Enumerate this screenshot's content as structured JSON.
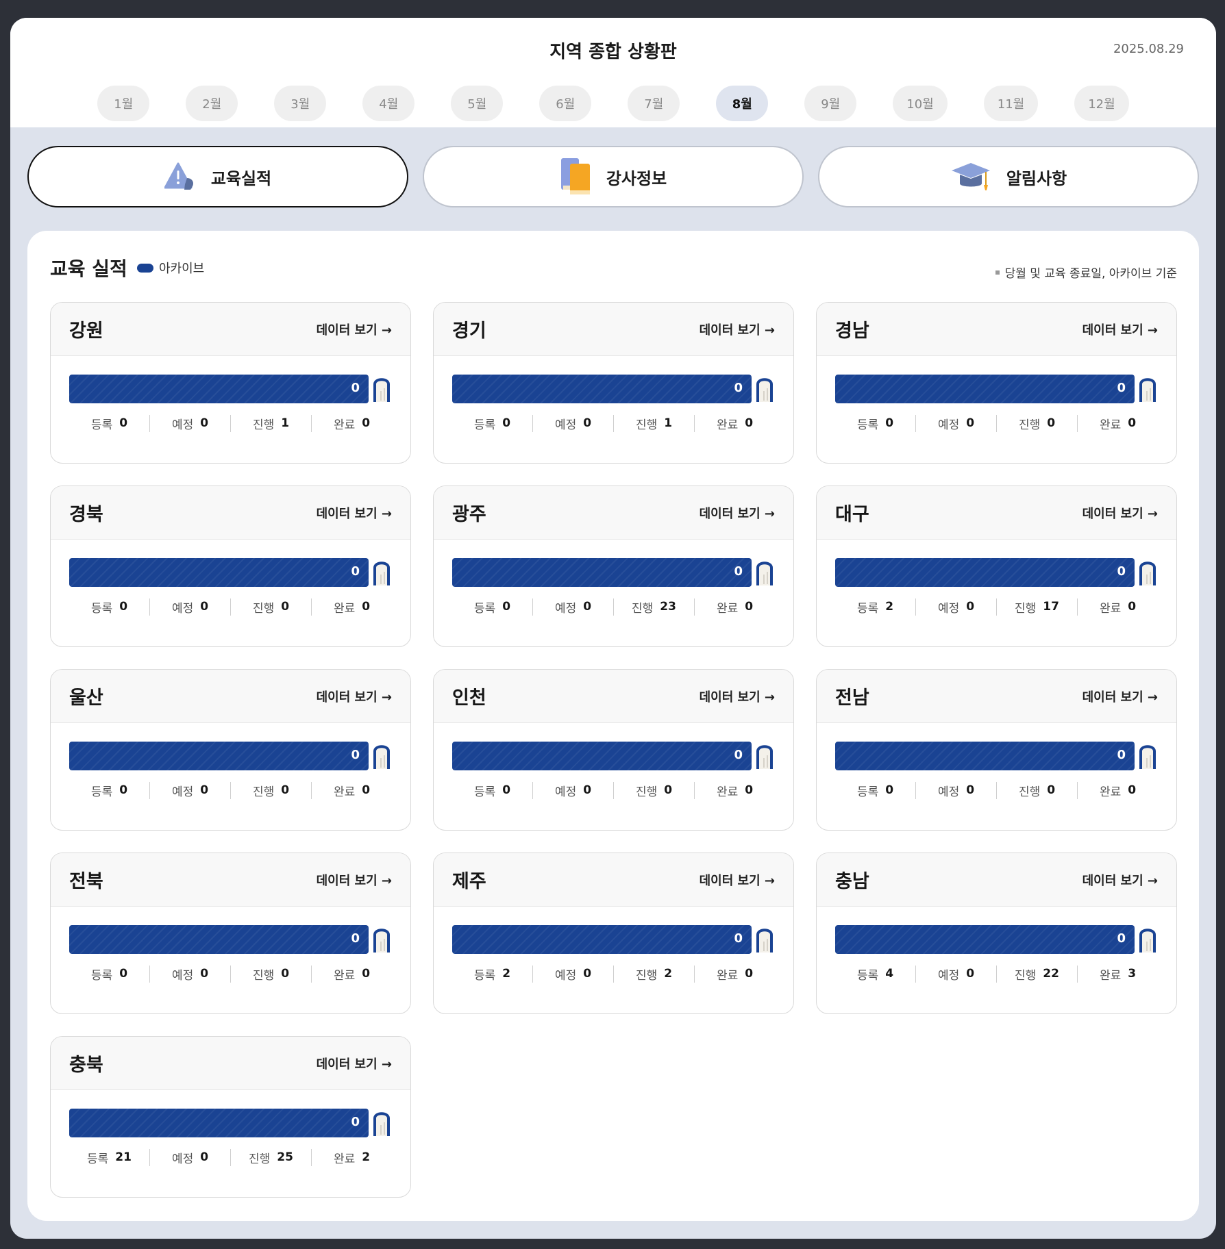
{
  "header": {
    "title": "지역 종합 상황판",
    "date": "2025.08.29",
    "months": [
      "1월",
      "2월",
      "3월",
      "4월",
      "5월",
      "6월",
      "7월",
      "8월",
      "9월",
      "10월",
      "11월",
      "12월"
    ],
    "active_month": "8월"
  },
  "tabs": [
    {
      "label": "교육실적",
      "icon": "warning-icon",
      "active": true
    },
    {
      "label": "강사정보",
      "icon": "books-icon",
      "active": false
    },
    {
      "label": "알림사항",
      "icon": "graduation-cap-icon",
      "active": false
    }
  ],
  "panel": {
    "title": "교육 실적",
    "legend_label": "아카이브",
    "note": "당월 및 교육 종료일, 아카이브 기준",
    "view_label": "데이터 보기 →",
    "stat_labels": {
      "registered": "등록",
      "scheduled": "예정",
      "in_progress": "진행",
      "completed": "완료"
    }
  },
  "colors": {
    "bar": "#1a4393",
    "accent_active_border": "#111111"
  },
  "regions": [
    {
      "name": "강원",
      "archive": "0",
      "registered": "0",
      "scheduled": "0",
      "in_progress": "1",
      "completed": "0"
    },
    {
      "name": "경기",
      "archive": "0",
      "registered": "0",
      "scheduled": "0",
      "in_progress": "1",
      "completed": "0"
    },
    {
      "name": "경남",
      "archive": "0",
      "registered": "0",
      "scheduled": "0",
      "in_progress": "0",
      "completed": "0"
    },
    {
      "name": "경북",
      "archive": "0",
      "registered": "0",
      "scheduled": "0",
      "in_progress": "0",
      "completed": "0"
    },
    {
      "name": "광주",
      "archive": "0",
      "registered": "0",
      "scheduled": "0",
      "in_progress": "23",
      "completed": "0"
    },
    {
      "name": "대구",
      "archive": "0",
      "registered": "2",
      "scheduled": "0",
      "in_progress": "17",
      "completed": "0"
    },
    {
      "name": "울산",
      "archive": "0",
      "registered": "0",
      "scheduled": "0",
      "in_progress": "0",
      "completed": "0"
    },
    {
      "name": "인천",
      "archive": "0",
      "registered": "0",
      "scheduled": "0",
      "in_progress": "0",
      "completed": "0"
    },
    {
      "name": "전남",
      "archive": "0",
      "registered": "0",
      "scheduled": "0",
      "in_progress": "0",
      "completed": "0"
    },
    {
      "name": "전북",
      "archive": "0",
      "registered": "0",
      "scheduled": "0",
      "in_progress": "0",
      "completed": "0"
    },
    {
      "name": "제주",
      "archive": "0",
      "registered": "2",
      "scheduled": "0",
      "in_progress": "2",
      "completed": "0"
    },
    {
      "name": "충남",
      "archive": "0",
      "registered": "4",
      "scheduled": "0",
      "in_progress": "22",
      "completed": "3"
    },
    {
      "name": "충북",
      "archive": "0",
      "registered": "21",
      "scheduled": "0",
      "in_progress": "25",
      "completed": "2"
    }
  ]
}
